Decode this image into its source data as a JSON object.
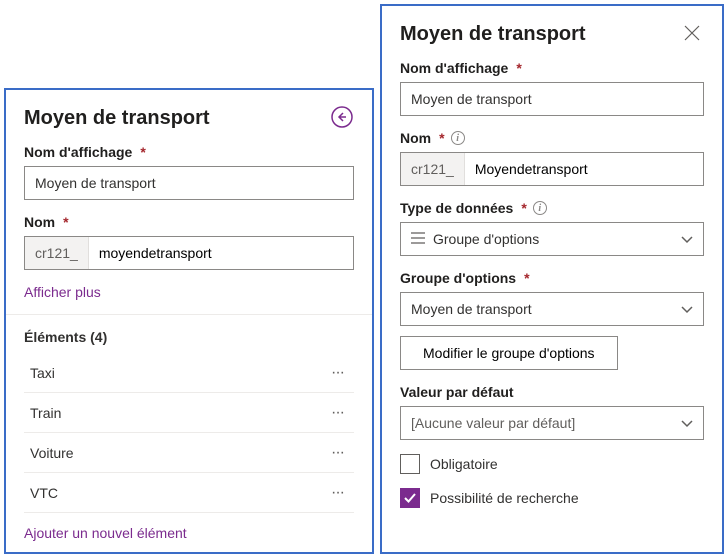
{
  "left": {
    "title": "Moyen de transport",
    "displayNameLabel": "Nom d'affichage",
    "displayNameValue": "Moyen de transport",
    "nameLabel": "Nom",
    "prefix": "cr121_",
    "nameValue": "moyendetransport",
    "showMore": "Afficher plus",
    "elementsTitle": "Éléments (4)",
    "items": [
      "Taxi",
      "Train",
      "Voiture",
      "VTC"
    ],
    "addItem": "Ajouter un nouvel élément"
  },
  "right": {
    "title": "Moyen de transport",
    "displayNameLabel": "Nom d'affichage",
    "displayNameValue": "Moyen de transport",
    "nameLabel": "Nom",
    "prefix": "cr121_",
    "nameValue": "Moyendetransport",
    "dataTypeLabel": "Type de données",
    "dataTypeValue": "Groupe d'options",
    "optionGroupLabel": "Groupe d'options",
    "optionGroupValue": "Moyen de transport",
    "editGroupBtn": "Modifier le groupe d'options",
    "defaultLabel": "Valeur par défaut",
    "defaultValue": "[Aucune valeur par défaut]",
    "requiredLabel": "Obligatoire",
    "searchableLabel": "Possibilité de recherche"
  }
}
